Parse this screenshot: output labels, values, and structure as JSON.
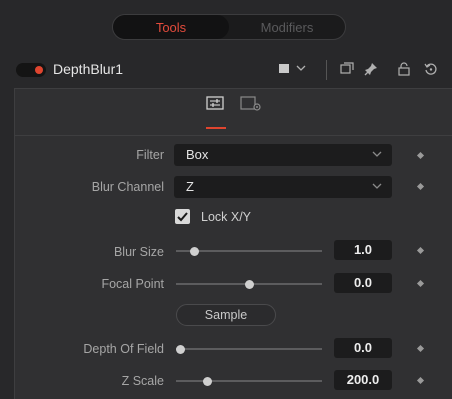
{
  "top_tabs": {
    "tools": "Tools",
    "modifiers": "Modifiers"
  },
  "tool": {
    "name": "DepthBlur1",
    "enabled": true
  },
  "header_icons": [
    "color-square-icon",
    "chevron-down-icon",
    "window-icon",
    "pin-icon",
    "lock-icon",
    "reset-icon"
  ],
  "params": {
    "filter": {
      "label": "Filter",
      "value": "Box"
    },
    "blur_channel": {
      "label": "Blur Channel",
      "value": "Z"
    },
    "lock_xy": {
      "label": "Lock X/Y",
      "checked": true
    },
    "blur_size": {
      "label": "Blur Size",
      "value": "1.0",
      "slider_fraction": 0.12
    },
    "focal_point": {
      "label": "Focal Point",
      "value": "0.0",
      "slider_fraction": 0.5
    },
    "sample": {
      "label": "Sample"
    },
    "depth_of_field": {
      "label": "Depth Of Field",
      "value": "0.0",
      "slider_fraction": 0.03
    },
    "z_scale": {
      "label": "Z Scale",
      "value": "200.0",
      "slider_fraction": 0.21
    }
  },
  "colors": {
    "accent": "#e0452f",
    "tab_active_text": "#e24b3c",
    "background": "#28282a"
  }
}
